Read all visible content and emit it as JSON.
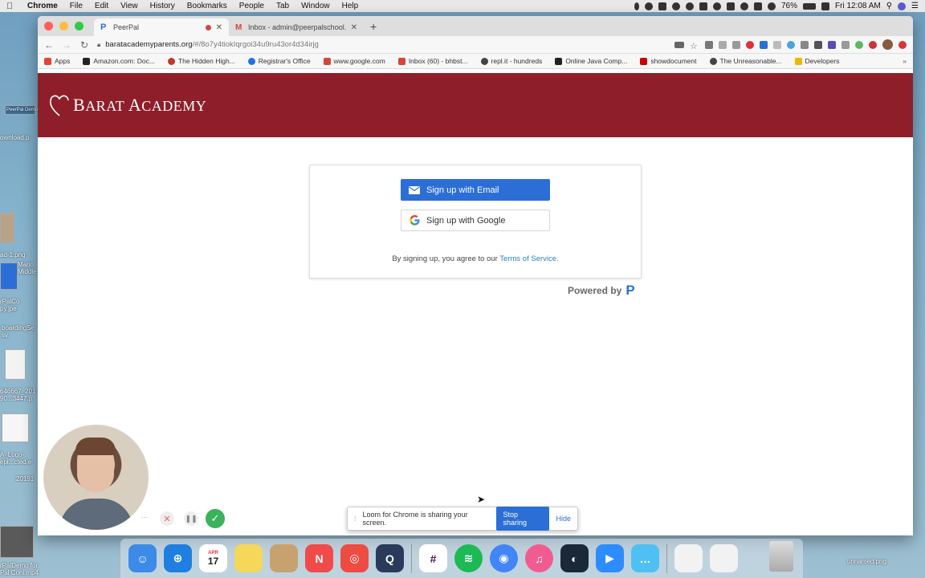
{
  "menubar": {
    "app": "Chrome",
    "items": [
      "File",
      "Edit",
      "View",
      "History",
      "Bookmarks",
      "People",
      "Tab",
      "Window",
      "Help"
    ],
    "battery": "76%",
    "clock": "Fri 12:08 AM"
  },
  "desktop": {
    "labels": [
      "PeerPal Demo",
      "ownload.p",
      "ad-1.png",
      "Marin Middle",
      "rPalCo py.jpe",
      "boardingSe sv",
      "646667_201 90...3447.p",
      "A_Logo- epl...cted.e",
      "20191",
      "rPalDemo for Pal Coni.mp4",
      "unnamed.png"
    ]
  },
  "tabs": [
    {
      "title": "PeerPal",
      "favicon": "P",
      "active": true
    },
    {
      "title": "Inbox - admin@peerpalschool.",
      "favicon": "M",
      "active": false
    }
  ],
  "address_bar": {
    "domain": "baratacademyparents.org",
    "path": "/#/8o7y4tiokIqrgoi34u9ru43or4d34irjg"
  },
  "bookmarks": [
    {
      "label": "Apps",
      "color": "#e94235"
    },
    {
      "label": "Amazon.com: Doc...",
      "color": "#222222"
    },
    {
      "label": "The Hidden High...",
      "color": "#c0392b"
    },
    {
      "label": "Registrar's Office",
      "color": "#1a73e8"
    },
    {
      "label": "www.google.com",
      "color": "#d44638"
    },
    {
      "label": "Inbox (60) - bhbst...",
      "color": "#d44638"
    },
    {
      "label": "repl.it - hundreds",
      "color": "#444444"
    },
    {
      "label": "Online Java Comp...",
      "color": "#222222"
    },
    {
      "label": "showdocument",
      "color": "#cc0000"
    },
    {
      "label": "The Unreasonable...",
      "color": "#444444"
    },
    {
      "label": "Developers",
      "color": "#f4b400"
    }
  ],
  "site": {
    "logo_first": "B",
    "logo_rest": "ARAT ",
    "logo_second": "A",
    "logo_rest2": "CADEMY",
    "header_color": "#8e1f2a"
  },
  "signup": {
    "email_label": "Sign up with Email",
    "google_label": "Sign up with Google",
    "terms_prefix": "By signing up, you agree to our ",
    "terms_link": "Terms of Service."
  },
  "powered": {
    "label": "Powered by",
    "logo": "P"
  },
  "loom": {
    "share_text": "Loom for Chrome is sharing your screen.",
    "stop_label": "Stop sharing",
    "hide_label": "Hide",
    "more": "···",
    "cancel": "✕",
    "pause": "❚❚",
    "done": "✓"
  },
  "dock": [
    {
      "name": "finder",
      "color": "#3d8be8",
      "glyph": "☺"
    },
    {
      "name": "safari",
      "color": "#1f7fe0",
      "glyph": "⊕"
    },
    {
      "name": "calendar",
      "color": "#ffffff",
      "glyph": "17"
    },
    {
      "name": "notes",
      "color": "#f5d75a",
      "glyph": ""
    },
    {
      "name": "preview",
      "color": "#c8a26e",
      "glyph": ""
    },
    {
      "name": "news",
      "color": "#f04b4b",
      "glyph": "N"
    },
    {
      "name": "affinity",
      "color": "#ee4b42",
      "glyph": "◎"
    },
    {
      "name": "quicktime",
      "color": "#2a3a5a",
      "glyph": "Q"
    },
    {
      "name": "slack",
      "color": "#ffffff",
      "glyph": "#"
    },
    {
      "name": "spotify",
      "color": "#1db954",
      "glyph": "≋"
    },
    {
      "name": "chrome",
      "color": "#4285f4",
      "glyph": "◉"
    },
    {
      "name": "itunes",
      "color": "#f25b8f",
      "glyph": "♫"
    },
    {
      "name": "steam",
      "color": "#1b2838",
      "glyph": "◐"
    },
    {
      "name": "zoom",
      "color": "#2d8cff",
      "glyph": "▶"
    },
    {
      "name": "messages",
      "color": "#4fc0f4",
      "glyph": "…"
    }
  ],
  "calendar": {
    "month": "APR",
    "day": "17"
  }
}
